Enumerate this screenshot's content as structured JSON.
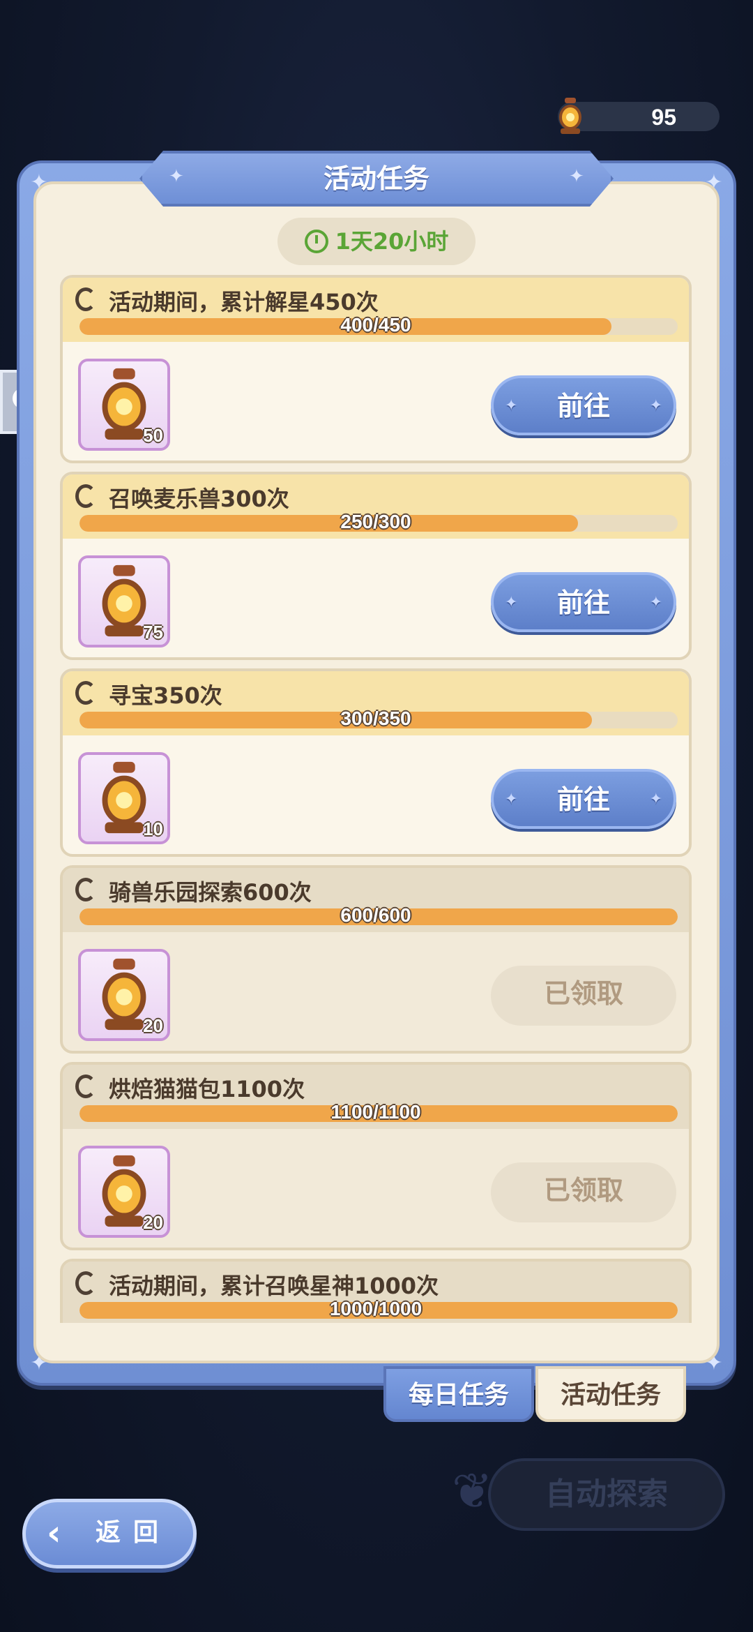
{
  "currency": {
    "icon": "lantern-icon",
    "value": "95"
  },
  "panel": {
    "title": "活动任务",
    "timer": "1天20小时"
  },
  "buttons": {
    "go": "前往",
    "claimed": "已领取"
  },
  "tasks": [
    {
      "title": "活动期间，累计解星450次",
      "progress": "400/450",
      "fraction": 0.889,
      "reward_count": "50",
      "status": "go"
    },
    {
      "title": "召唤麦乐兽300次",
      "progress": "250/300",
      "fraction": 0.833,
      "reward_count": "75",
      "status": "go"
    },
    {
      "title": "寻宝350次",
      "progress": "300/350",
      "fraction": 0.857,
      "reward_count": "10",
      "status": "go"
    },
    {
      "title": "骑兽乐园探索600次",
      "progress": "600/600",
      "fraction": 1.0,
      "reward_count": "20",
      "status": "claimed"
    },
    {
      "title": "烘焙猫猫包1100次",
      "progress": "1100/1100",
      "fraction": 1.0,
      "reward_count": "20",
      "status": "claimed"
    },
    {
      "title": "活动期间，累计召唤星神1000次",
      "progress": "1000/1000",
      "fraction": 1.0,
      "reward_count": "",
      "status": "claimed"
    }
  ],
  "tabs": {
    "daily": "每日任务",
    "activity": "活动任务"
  },
  "auto_explore": "自动探索",
  "back": "返回",
  "colors": {
    "accent_blue": "#6f8fd3",
    "progress_orange": "#f0a64a",
    "timer_green": "#5aa536"
  }
}
